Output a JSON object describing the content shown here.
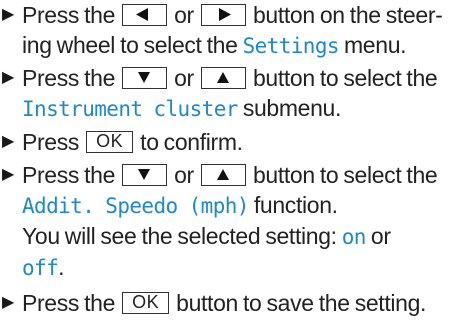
{
  "steps": [
    {
      "line1_a": "Press the",
      "line1_b": "or",
      "line1_c": "button on the steer-",
      "line2_a": "ing wheel to select the",
      "line2_mono": "Settings",
      "line2_b": "menu."
    },
    {
      "line1_a": "Press the",
      "line1_b": "or",
      "line1_c": "button to select the",
      "line2_mono": "Instrument cluster",
      "line2_b": "submenu."
    },
    {
      "line1_a": "Press",
      "key": "OK",
      "line1_b": "to confirm."
    },
    {
      "line1_a": "Press the",
      "line1_b": "or",
      "line1_c": "button to select the",
      "line2_mono": "Addit. Speedo (mph)",
      "line2_b": "function.",
      "line3": "You will see the selected setting:",
      "on": "on",
      "or": "or",
      "off": "off",
      "period": "."
    },
    {
      "line1_a": "Press the",
      "key": "OK",
      "line1_b": "button to save the setting."
    }
  ],
  "icons": {
    "bullet": "triangle-right",
    "left": "arrow-left",
    "right": "arrow-right",
    "down": "arrow-down",
    "up": "arrow-up"
  },
  "colors": {
    "accent": "#1e88cc",
    "text": "#222222"
  }
}
